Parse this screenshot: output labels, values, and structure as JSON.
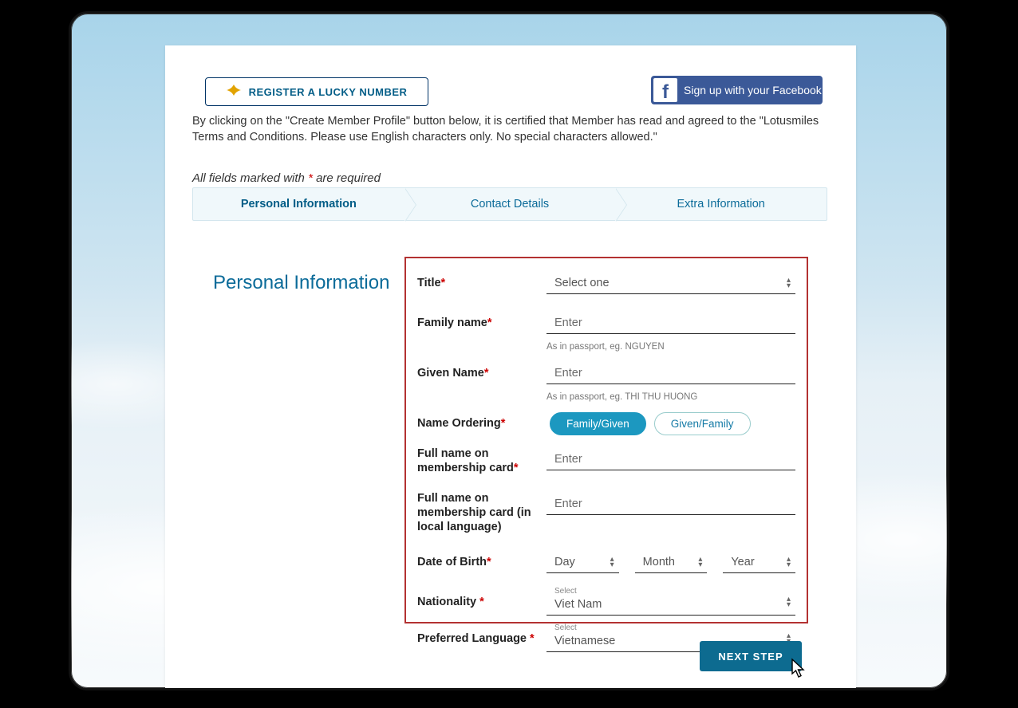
{
  "header": {
    "lucky_number_label": "REGISTER A LUCKY NUMBER",
    "facebook_label": "Sign up with your Facebook",
    "terms_text": "By clicking on the \"Create Member Profile\" button below, it is certified that Member has read and agreed to the \"Lotusmiles Terms and Conditions. Please use English characters only. No special characters allowed.\"",
    "required_note_pre": "All fields marked with ",
    "required_note_post": " are required"
  },
  "steps": {
    "s1": "Personal Information",
    "s2": "Contact Details",
    "s3": "Extra Information"
  },
  "section_title": "Personal Information",
  "form": {
    "title": {
      "label": "Title",
      "value": "Select one"
    },
    "family_name": {
      "label": "Family name",
      "placeholder": "Enter",
      "hint": "As in passport, eg. NGUYEN"
    },
    "given_name": {
      "label": "Given Name",
      "placeholder": "Enter",
      "hint": "As in passport, eg. THI THU HUONG"
    },
    "name_ordering": {
      "label": "Name Ordering",
      "opt1": "Family/Given",
      "opt2": "Given/Family"
    },
    "full_name_card": {
      "label": "Full name on membership card",
      "placeholder": "Enter"
    },
    "full_name_card_local": {
      "label": "Full name on membership card (in local language)",
      "placeholder": "Enter"
    },
    "dob": {
      "label": "Date of Birth",
      "day": "Day",
      "month": "Month",
      "year": "Year"
    },
    "nationality": {
      "label": "Nationality ",
      "tiny": "Select",
      "value": "Viet Nam"
    },
    "language": {
      "label": "Preferred Language ",
      "tiny": "Select",
      "value": "Vietnamese"
    }
  },
  "next_button": "NEXT STEP"
}
